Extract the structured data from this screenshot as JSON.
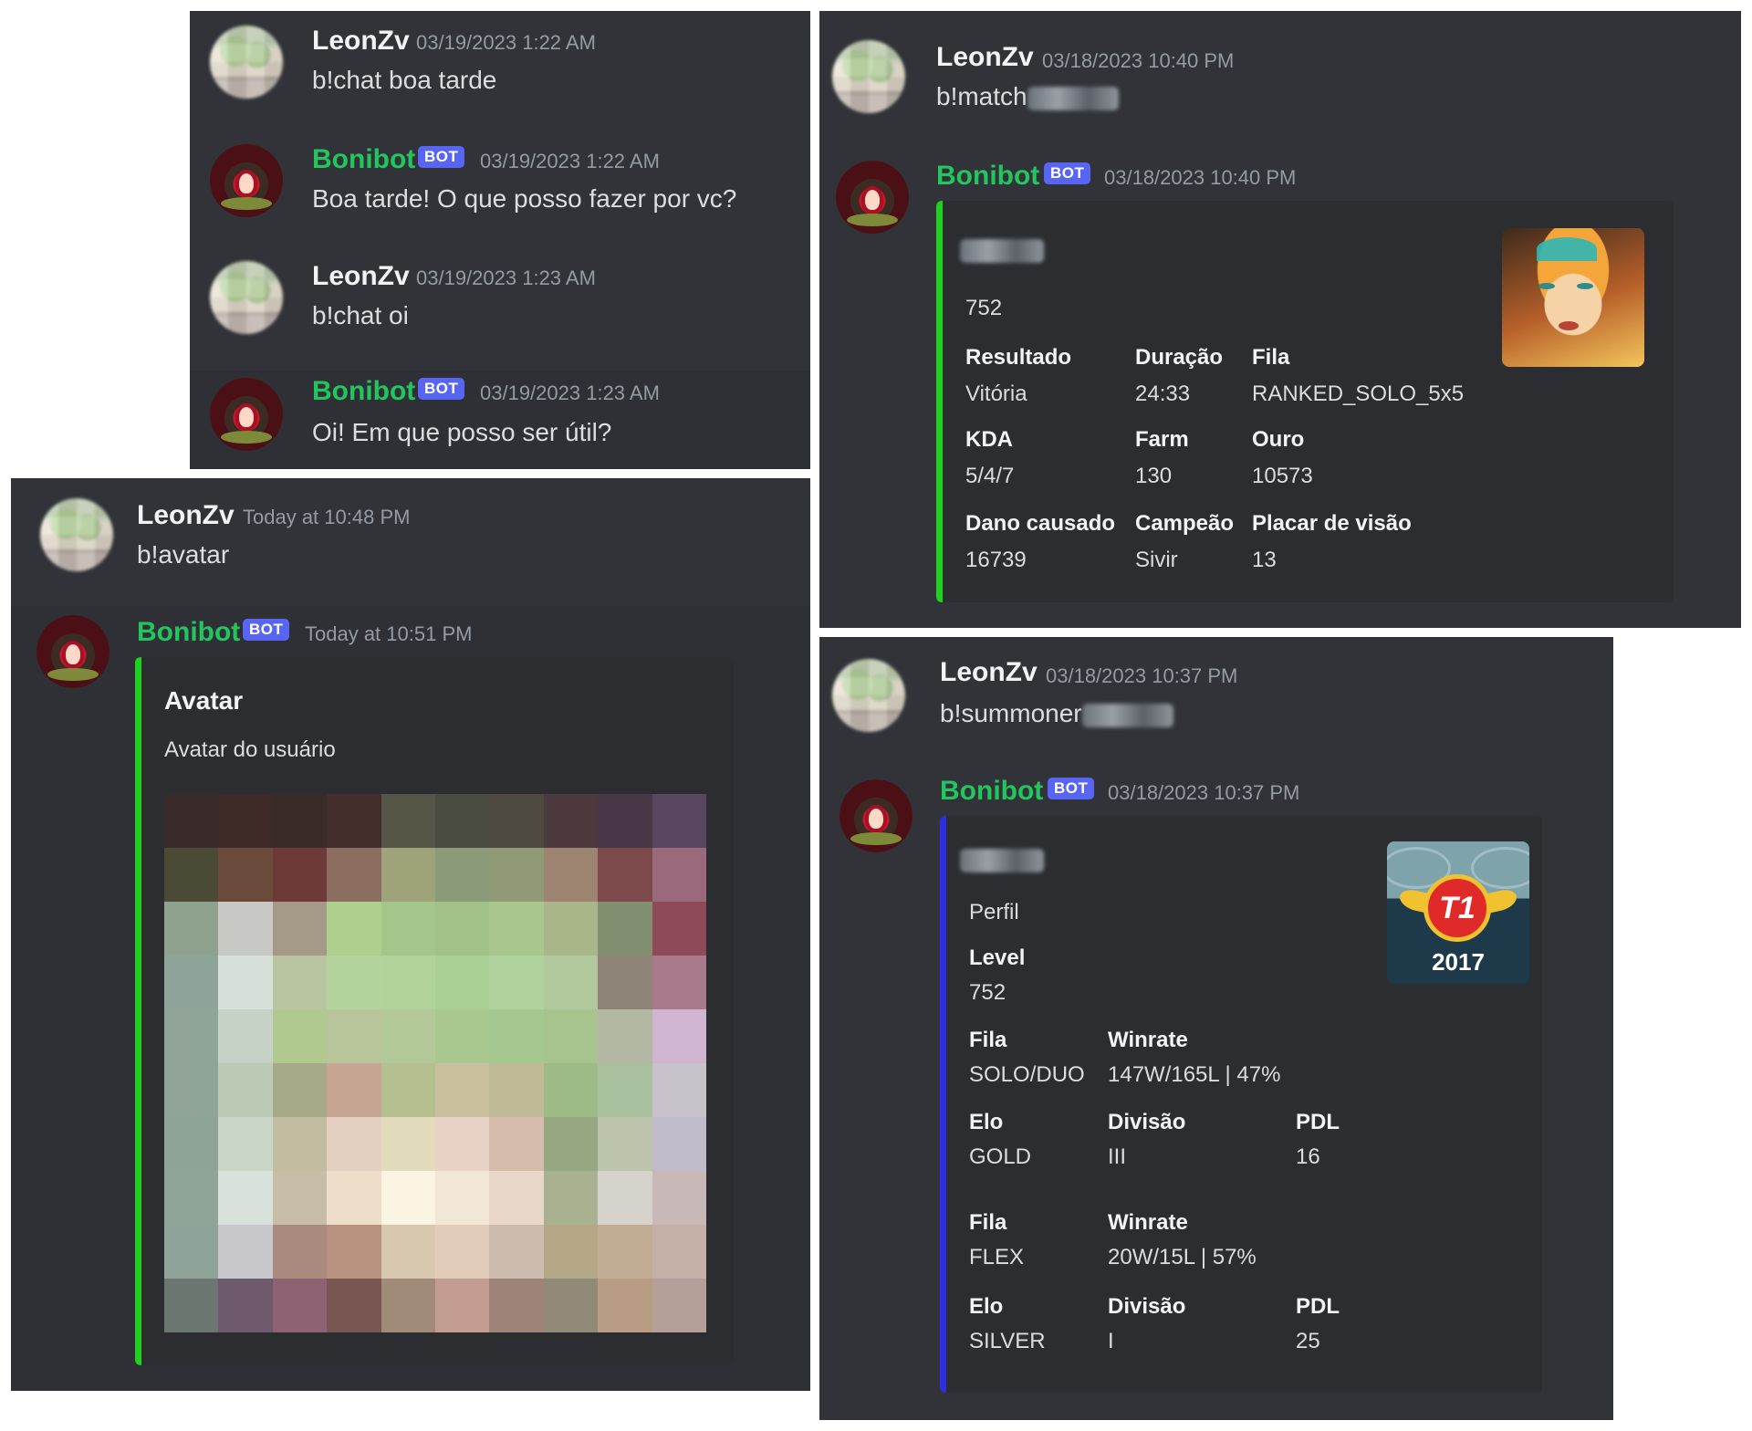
{
  "panel1": {
    "messages": [
      {
        "author": "LeonZv",
        "time": "03/19/2023 1:22 AM",
        "text": "b!chat boa tarde"
      },
      {
        "author": "Bonibot",
        "badge": "BOT",
        "time": "03/19/2023 1:22 AM",
        "text": "Boa tarde! O que posso fazer por vc?"
      },
      {
        "author": "LeonZv",
        "time": "03/19/2023 1:23 AM",
        "text": "b!chat oi"
      },
      {
        "author": "Bonibot",
        "badge": "BOT",
        "time": "03/19/2023 1:23 AM",
        "text": "Oi! Em que posso ser útil?"
      }
    ]
  },
  "panel2": {
    "user": {
      "author": "LeonZv",
      "time": "Today at 10:48 PM",
      "text": "b!avatar"
    },
    "bot": {
      "author": "Bonibot",
      "badge": "BOT",
      "time": "Today at 10:51 PM"
    },
    "embed": {
      "title": "Avatar",
      "description": "Avatar do usuário",
      "bar_color": "#1fd11f"
    },
    "avatar_pixels": [
      "#3a2b2a",
      "#3e2a27",
      "#3a2a28",
      "#432e2c",
      "#555645",
      "#4b4c40",
      "#4f4a40",
      "#4d3a3e",
      "#493646",
      "#5b4660",
      "#4b4a35",
      "#6a4a3a",
      "#6e3a38",
      "#8b6e5f",
      "#9ea37a",
      "#8b9a78",
      "#909a76",
      "#9c8470",
      "#7c4a4a",
      "#9a6a7c",
      "#8ea28e",
      "#c8c8c4",
      "#a59a88",
      "#aed08c",
      "#a4c68a",
      "#a2c189",
      "#a9c68e",
      "#a8b68a",
      "#828e70",
      "#8e4a58",
      "#8fa498",
      "#d6dfd8",
      "#b8c5a0",
      "#b3d49c",
      "#b2d49a",
      "#aad095",
      "#b0d29c",
      "#b0c89c",
      "#8e8478",
      "#a87a8c",
      "#90a598",
      "#c6d2c5",
      "#b0c98f",
      "#b8c49a",
      "#b4c999",
      "#a8c88f",
      "#a4c890",
      "#a7c48e",
      "#b2b8a3",
      "#cfb5d0",
      "#90a498",
      "#bccbb6",
      "#a6aa88",
      "#c7a694",
      "#b4c08f",
      "#cbc09e",
      "#bebb96",
      "#9dbb86",
      "#a8c09e",
      "#c8c2cb",
      "#8ea496",
      "#cad6c8",
      "#c2bca0",
      "#e4d0c0",
      "#e2dcbc",
      "#e8d2c6",
      "#d6bcaa",
      "#96a882",
      "#bcc4ac",
      "#c0bccc",
      "#8ea598",
      "#d8e2da",
      "#c8bda6",
      "#ecdec8",
      "#fcf4e2",
      "#f2e6d6",
      "#e9d8ca",
      "#a8b290",
      "#d6d2cc",
      "#c8b8b8",
      "#8ea498",
      "#c8c8cc",
      "#a88a7e",
      "#b89480",
      "#d8c8b0",
      "#e0ccb8",
      "#ccbcb0",
      "#b4a886",
      "#c2ac94",
      "#c4b0a6",
      "#6c7670",
      "#6e5a6c",
      "#8e6272",
      "#7a5652",
      "#a08a78",
      "#c29c90",
      "#9e8478",
      "#928a78",
      "#b89c84",
      "#b4a098"
    ]
  },
  "panel3": {
    "user": {
      "author": "LeonZv",
      "time": "03/18/2023 10:40 PM",
      "text": "b!match"
    },
    "bot": {
      "author": "Bonibot",
      "badge": "BOT",
      "time": "03/18/2023 10:40 PM"
    },
    "embed": {
      "bar_color": "#1fd11f",
      "value_top": "752",
      "thumbnail_icon": "champion-portrait",
      "fields": [
        {
          "label": "Resultado",
          "value": "Vitória"
        },
        {
          "label": "Duração",
          "value": "24:33"
        },
        {
          "label": "Fila",
          "value": "RANKED_SOLO_5x5"
        },
        {
          "label": "KDA",
          "value": "5/4/7"
        },
        {
          "label": "Farm",
          "value": "130"
        },
        {
          "label": "Ouro",
          "value": "10573"
        },
        {
          "label": "Dano causado",
          "value": "16739"
        },
        {
          "label": "Campeão",
          "value": "Sivir"
        },
        {
          "label": "Placar de visão",
          "value": "13"
        }
      ]
    }
  },
  "panel4": {
    "user": {
      "author": "LeonZv",
      "time": "03/18/2023 10:37 PM",
      "text": "b!summoner"
    },
    "bot": {
      "author": "Bonibot",
      "badge": "BOT",
      "time": "03/18/2023 10:37 PM"
    },
    "embed": {
      "bar_color": "#2e2ee0",
      "perfil": "Perfil",
      "level_label": "Level",
      "level_value": "752",
      "thumbnail_year": "2017",
      "thumbnail_emblem": "T1",
      "queues": [
        {
          "fila_label": "Fila",
          "fila_value": "SOLO/DUO",
          "winrate_label": "Winrate",
          "winrate_value": "147W/165L | 47%",
          "elo_label": "Elo",
          "elo_value": "GOLD",
          "divisao_label": "Divisão",
          "divisao_value": "III",
          "pdl_label": "PDL",
          "pdl_value": "16"
        },
        {
          "fila_label": "Fila",
          "fila_value": "FLEX",
          "winrate_label": "Winrate",
          "winrate_value": "20W/15L | 57%",
          "elo_label": "Elo",
          "elo_value": "SILVER",
          "divisao_label": "Divisão",
          "divisao_value": "I",
          "pdl_label": "PDL",
          "pdl_value": "25"
        }
      ]
    }
  }
}
